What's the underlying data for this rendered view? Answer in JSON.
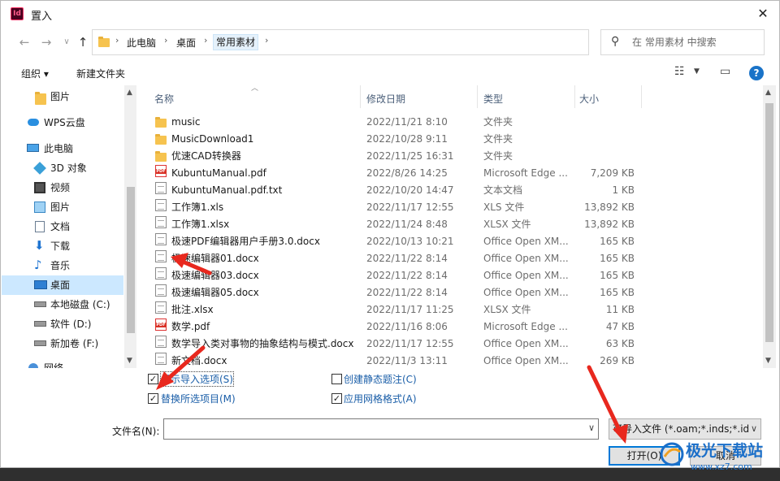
{
  "window": {
    "title": "置入",
    "app_icon_text": "Id"
  },
  "nav": {
    "back_icon": "arrow-left-icon",
    "forward_icon": "arrow-right-icon",
    "recent_icon": "chevron-down-icon",
    "up_icon": "arrow-up-icon"
  },
  "breadcrumb": [
    "此电脑",
    "桌面",
    "常用素材"
  ],
  "search": {
    "placeholder": "在 常用素材 中搜索"
  },
  "toolbar": {
    "organize_label": "组织 ▾",
    "new_folder_label": "新建文件夹"
  },
  "sidebar": {
    "items": [
      {
        "label": "图片",
        "icon": "folder-icon",
        "indent": 1
      },
      {
        "label": "WPS云盘",
        "icon": "cloud-icon",
        "indent": 0
      },
      {
        "label": "此电脑",
        "icon": "computer-icon",
        "indent": 0
      },
      {
        "label": "3D 对象",
        "icon": "cube-icon",
        "indent": 1
      },
      {
        "label": "视频",
        "icon": "video-icon",
        "indent": 1
      },
      {
        "label": "图片",
        "icon": "picture-icon",
        "indent": 1
      },
      {
        "label": "文档",
        "icon": "document-icon",
        "indent": 1
      },
      {
        "label": "下载",
        "icon": "download-icon",
        "indent": 1
      },
      {
        "label": "音乐",
        "icon": "music-icon",
        "indent": 1
      },
      {
        "label": "桌面",
        "icon": "desktop-icon",
        "indent": 1,
        "selected": true
      },
      {
        "label": "本地磁盘 (C:)",
        "icon": "drive-icon",
        "indent": 1
      },
      {
        "label": "软件 (D:)",
        "icon": "drive-icon",
        "indent": 1
      },
      {
        "label": "新加卷 (F:)",
        "icon": "drive-icon",
        "indent": 1
      },
      {
        "label": "网络",
        "icon": "network-icon",
        "indent": 0
      }
    ]
  },
  "columns": {
    "name": "名称",
    "date": "修改日期",
    "type": "类型",
    "size": "大小"
  },
  "files": [
    {
      "name": "music",
      "date": "2022/11/21 8:10",
      "type": "文件夹",
      "size": "",
      "icon": "folder"
    },
    {
      "name": "MusicDownload1",
      "date": "2022/10/28 9:11",
      "type": "文件夹",
      "size": "",
      "icon": "folder"
    },
    {
      "name": "优速CAD转换器",
      "date": "2022/11/25 16:31",
      "type": "文件夹",
      "size": "",
      "icon": "folder"
    },
    {
      "name": "KubuntuManual.pdf",
      "date": "2022/8/26 14:25",
      "type": "Microsoft Edge ...",
      "size": "7,209 KB",
      "icon": "pdf"
    },
    {
      "name": "KubuntuManual.pdf.txt",
      "date": "2022/10/20 14:47",
      "type": "文本文档",
      "size": "1 KB",
      "icon": "doc"
    },
    {
      "name": "工作簿1.xls",
      "date": "2022/11/17 12:55",
      "type": "XLS 文件",
      "size": "13,892 KB",
      "icon": "doc"
    },
    {
      "name": "工作簿1.xlsx",
      "date": "2022/11/24 8:48",
      "type": "XLSX 文件",
      "size": "13,892 KB",
      "icon": "doc"
    },
    {
      "name": "极速PDF编辑器用户手册3.0.docx",
      "date": "2022/10/13 10:21",
      "type": "Office Open XM...",
      "size": "165 KB",
      "icon": "doc"
    },
    {
      "name": "极速编辑器01.docx",
      "date": "2022/11/22 8:14",
      "type": "Office Open XM...",
      "size": "165 KB",
      "icon": "doc"
    },
    {
      "name": "极速编辑器03.docx",
      "date": "2022/11/22 8:14",
      "type": "Office Open XM...",
      "size": "165 KB",
      "icon": "doc"
    },
    {
      "name": "极速编辑器05.docx",
      "date": "2022/11/22 8:14",
      "type": "Office Open XM...",
      "size": "165 KB",
      "icon": "doc"
    },
    {
      "name": "批注.xlsx",
      "date": "2022/11/17 11:25",
      "type": "XLSX 文件",
      "size": "11 KB",
      "icon": "doc"
    },
    {
      "name": "数学.pdf",
      "date": "2022/11/16 8:06",
      "type": "Microsoft Edge ...",
      "size": "47 KB",
      "icon": "pdf"
    },
    {
      "name": "数学导入类对事物的抽象结构与模式.docx",
      "date": "2022/11/17 12:55",
      "type": "Office Open XM...",
      "size": "63 KB",
      "icon": "doc"
    },
    {
      "name": "新文档.docx",
      "date": "2022/11/3 13:11",
      "type": "Office Open XM...",
      "size": "269 KB",
      "icon": "doc"
    }
  ],
  "options": {
    "show_import_options": {
      "label": "显示导入选项(S)",
      "checked": true
    },
    "replace_selected": {
      "label": "替换所选项目(M)",
      "checked": true
    },
    "create_static_caption": {
      "label": "创建静态题注(C)",
      "checked": false
    },
    "apply_grid_format": {
      "label": "应用网格格式(A)",
      "checked": true
    }
  },
  "filename": {
    "label": "文件名(N):",
    "value": ""
  },
  "filetype": {
    "value": "可导入文件 (*.oam;*.inds;*.idr"
  },
  "buttons": {
    "open": "打开(O)",
    "cancel": "取消"
  },
  "watermark": {
    "title": "极光下载站",
    "url": "www.xz7.com"
  },
  "colors": {
    "accent": "#0078d7",
    "selection": "#cce8ff",
    "annotation": "#e8281e"
  }
}
